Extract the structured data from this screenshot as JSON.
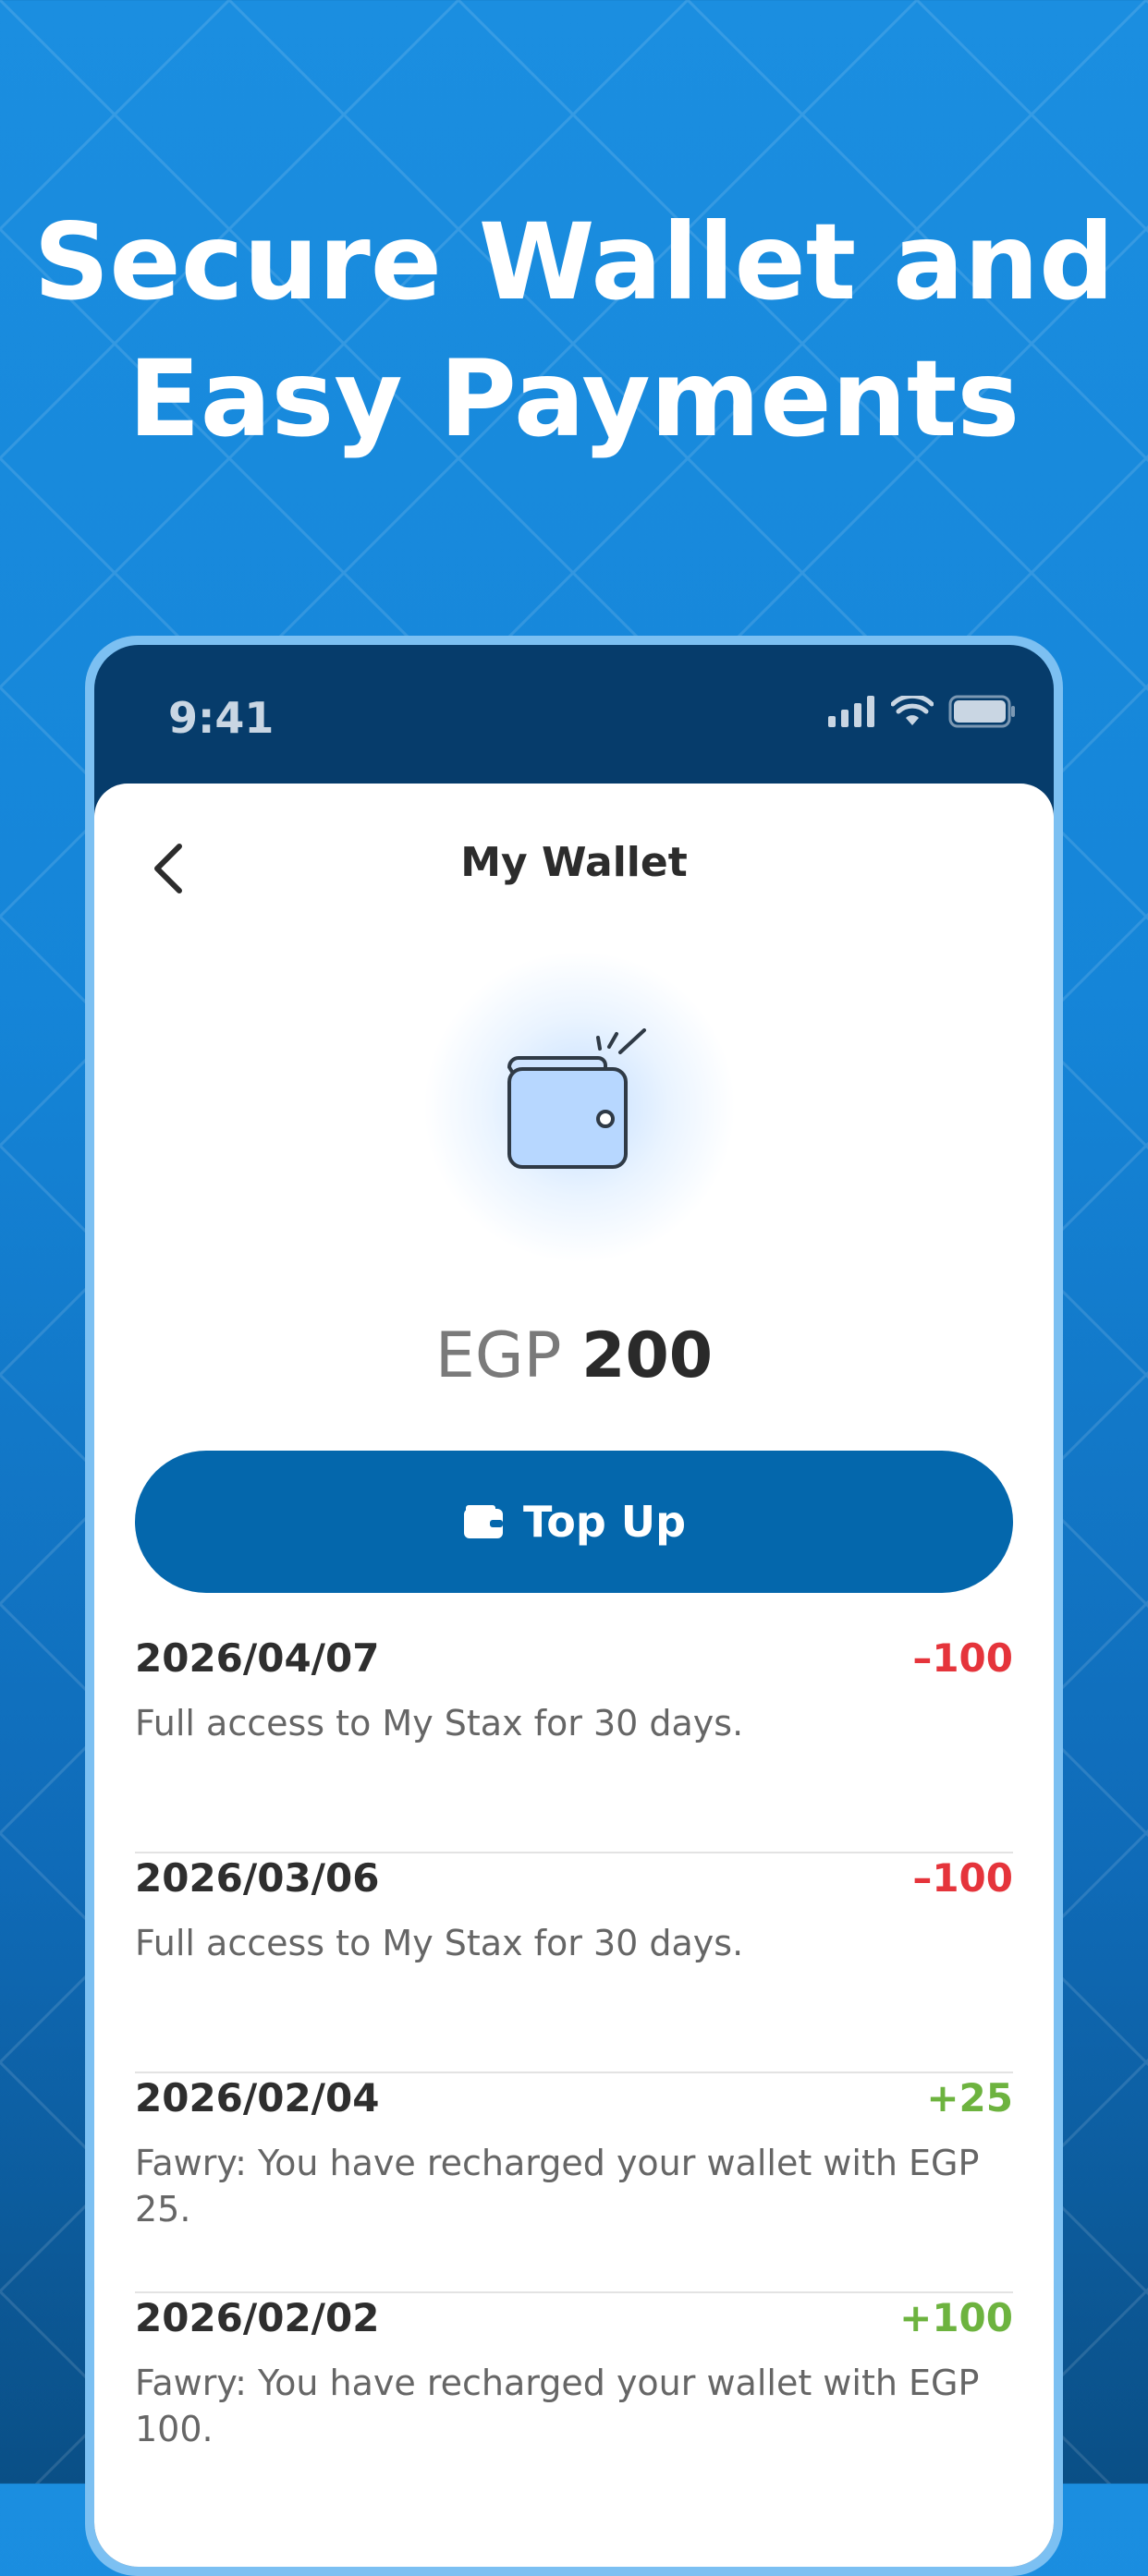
{
  "headline": {
    "line1": "Secure Wallet and",
    "line2": "Easy Payments"
  },
  "status_bar": {
    "time": "9:41"
  },
  "header": {
    "title": "My Wallet"
  },
  "balance": {
    "currency": "EGP",
    "amount": "200"
  },
  "top_up": {
    "label": "Top Up"
  },
  "transactions": [
    {
      "date": "2026/04/07",
      "amount": "–100",
      "type": "debit",
      "description": "Full access to My Stax for 30 days."
    },
    {
      "date": "2026/03/06",
      "amount": "–100",
      "type": "debit",
      "description": "Full access to My Stax for 30 days."
    },
    {
      "date": "2026/02/04",
      "amount": "+25",
      "type": "credit",
      "description": "Fawry: You have recharged your wallet with EGP 25."
    },
    {
      "date": "2026/02/02",
      "amount": "+100",
      "type": "credit",
      "description": "Fawry: You have recharged your wallet with EGP 100."
    }
  ],
  "colors": {
    "debit": "#e5343b",
    "credit": "#6db33f",
    "primary_button": "#0467ac",
    "background": "#1b8ee0"
  },
  "icons": {
    "back": "chevron-left-icon",
    "wallet_illustration": "wallet-icon",
    "top_up": "wallet-card-icon",
    "signal": "signal-icon",
    "wifi": "wifi-icon",
    "battery": "battery-icon"
  }
}
